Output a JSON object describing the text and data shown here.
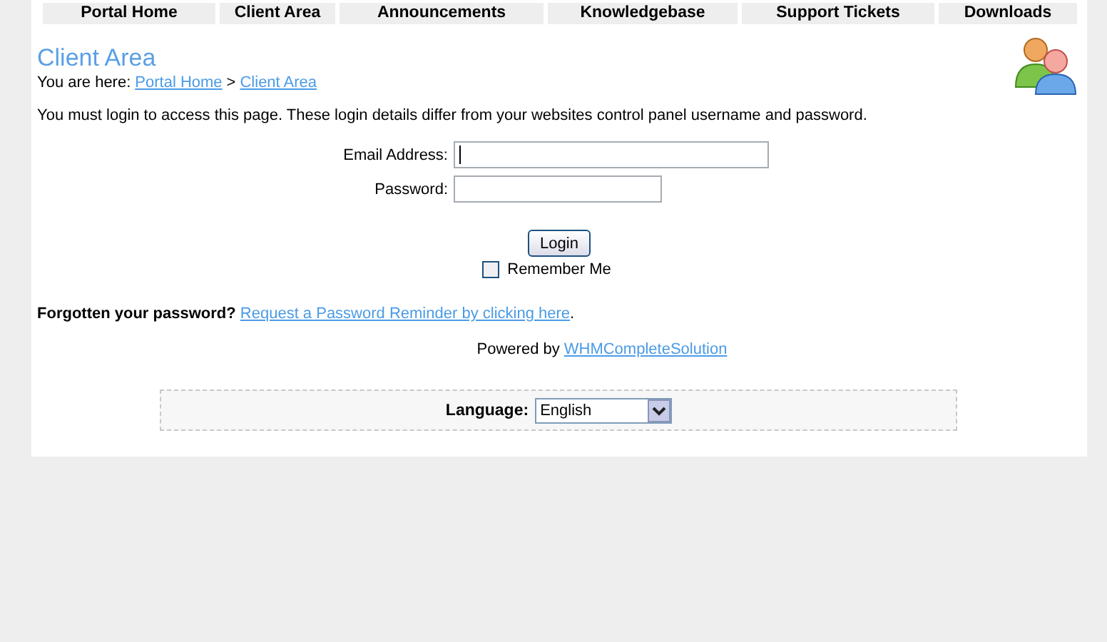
{
  "nav": [
    {
      "label": "Portal Home"
    },
    {
      "label": "Client Area"
    },
    {
      "label": "Announcements"
    },
    {
      "label": "Knowledgebase"
    },
    {
      "label": "Support Tickets"
    },
    {
      "label": "Downloads"
    }
  ],
  "title": "Client Area",
  "breadcrumb": {
    "prefix": "You are here:",
    "items": [
      "Portal Home",
      "Client Area"
    ],
    "separator": ">"
  },
  "intro": "You must login to access this page. These login details differ from your websites control panel username and password.",
  "form": {
    "fields": [
      {
        "label": "Email Address:",
        "kind": "text",
        "focused": true
      },
      {
        "label": "Password:",
        "kind": "password",
        "focused": false
      }
    ],
    "button": "Login",
    "remember": {
      "label": "Remember Me",
      "checked": false
    }
  },
  "forgot": {
    "question": "Forgotten your password?",
    "link": "Request a Password Reminder by clicking here",
    "end": "."
  },
  "powered": {
    "text": "Powered by",
    "link": "WHMCompleteSolution"
  },
  "language": {
    "label": "Language:",
    "value": "English"
  }
}
